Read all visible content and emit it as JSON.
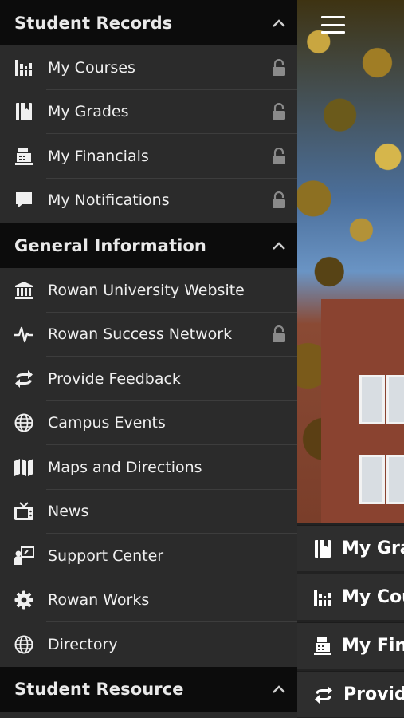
{
  "drawer": {
    "sections": [
      {
        "title": "Student Records",
        "items": [
          {
            "label": "My Courses",
            "icon": "books-icon",
            "locked": true
          },
          {
            "label": "My Grades",
            "icon": "book-icon",
            "locked": true
          },
          {
            "label": "My Financials",
            "icon": "cash-register-icon",
            "locked": true
          },
          {
            "label": "My Notifications",
            "icon": "speech-bubble-icon",
            "locked": true
          }
        ]
      },
      {
        "title": "General Information",
        "items": [
          {
            "label": "Rowan University Website",
            "icon": "university-icon",
            "locked": false
          },
          {
            "label": "Rowan Success Network",
            "icon": "heartbeat-icon",
            "locked": true
          },
          {
            "label": "Provide Feedback",
            "icon": "exchange-icon",
            "locked": false
          },
          {
            "label": "Campus Events",
            "icon": "globe-icon",
            "locked": false
          },
          {
            "label": "Maps and Directions",
            "icon": "map-icon",
            "locked": false
          },
          {
            "label": "News",
            "icon": "tv-icon",
            "locked": false
          },
          {
            "label": "Support Center",
            "icon": "presenter-icon",
            "locked": false
          },
          {
            "label": "Rowan Works",
            "icon": "gear-icon",
            "locked": false
          },
          {
            "label": "Directory",
            "icon": "globe-icon",
            "locked": false
          }
        ]
      },
      {
        "title": "Student Resource",
        "items": []
      }
    ]
  },
  "home": {
    "tiles": [
      {
        "label": "My Gra",
        "icon": "book-icon"
      },
      {
        "label": "My Cou",
        "icon": "books-icon"
      },
      {
        "label": "My Fina",
        "icon": "cash-register-icon"
      },
      {
        "label": "Provide",
        "icon": "exchange-icon"
      }
    ]
  },
  "colors": {
    "drawer_bg": "#2b2b2b",
    "section_header_bg": "#0c0c0c",
    "text": "#f0f0f0",
    "lock": "#8a8a8a"
  }
}
